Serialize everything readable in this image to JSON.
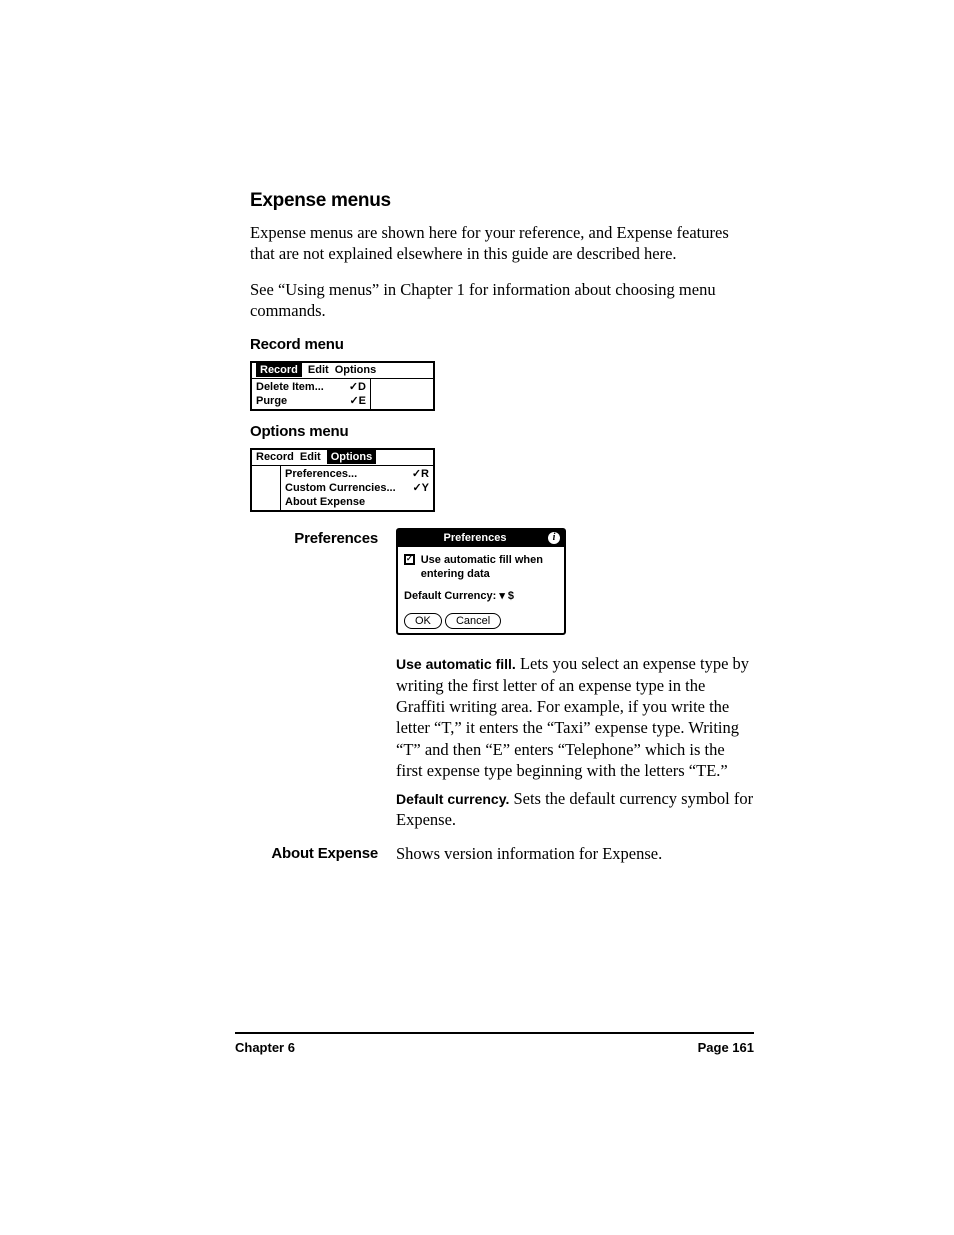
{
  "headings": {
    "h2": "Expense menus",
    "h3_record": "Record menu",
    "h3_options": "Options menu"
  },
  "paragraphs": {
    "p1": "Expense menus are shown here for your reference, and Expense features that are not explained elsewhere in this guide are described here.",
    "p2": "See “Using menus” in Chapter 1 for information about choosing menu commands."
  },
  "record_menu": {
    "bar": [
      "Record",
      "Edit",
      "Options"
    ],
    "items": [
      {
        "label": "Delete Item...",
        "shortcut": "✓D"
      },
      {
        "label": "Purge",
        "shortcut": "✓E"
      }
    ]
  },
  "options_menu": {
    "bar": [
      "Record",
      "Edit",
      "Options"
    ],
    "items": [
      {
        "label": "Preferences...",
        "shortcut": "✓R"
      },
      {
        "label": "Custom Currencies...",
        "shortcut": "✓Y"
      },
      {
        "label": "About Expense",
        "shortcut": ""
      }
    ]
  },
  "definitions": {
    "preferences_term": "Preferences",
    "about_term": "About Expense",
    "use_auto_title": "Use automatic fill.",
    "use_auto_body": " Lets you select an expense type by writing the first letter of an expense type in the Graffiti writing area. For example, if you write the letter “T,” it enters the “Taxi” expense type. Writing “T” and then “E” enters “Telephone” which is the first expense type beginning with the letters “TE.”",
    "default_curr_title": "Default currency.",
    "default_curr_body": " Sets the default currency symbol for Expense.",
    "about_body": "Shows version information for Expense."
  },
  "pref_dialog": {
    "title": "Preferences",
    "info_glyph": "i",
    "checkbox_glyph": "✓",
    "checkbox_label": "Use automatic fill when entering data",
    "currency_label": "Default Currency:",
    "currency_value": "▾ $",
    "ok": "OK",
    "cancel": "Cancel"
  },
  "footer": {
    "left": "Chapter 6",
    "right": "Page 161"
  }
}
